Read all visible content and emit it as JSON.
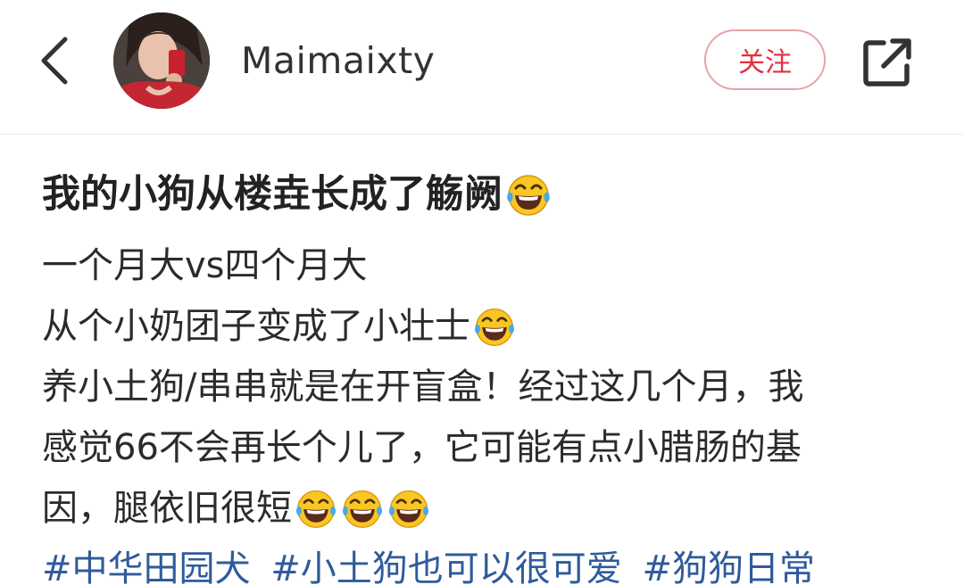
{
  "header": {
    "username": "Maimaixty",
    "follow_label": "关注"
  },
  "icons": {
    "back": "chevron-left-icon",
    "share": "share-external-icon",
    "emoji": "laughing-tears-emoji-icon"
  },
  "colors": {
    "follow_text": "#e0303f",
    "follow_border": "#e8a3a8",
    "hashtag": "#2f5b9b"
  },
  "post": {
    "title": "我的小狗从楼垚长成了觞阙",
    "lines": [
      "一个月大vs四个月大",
      "从个小奶团子变成了小壮士",
      "养小土狗/串串就是在开盲盒！经过这几个月，我",
      "感觉66不会再长个儿了，它可能有点小腊肠的基",
      "因，腿依旧很短"
    ],
    "hashtags": [
      "#中华田园犬",
      "#小土狗也可以很可爱",
      "#狗狗日常"
    ]
  }
}
